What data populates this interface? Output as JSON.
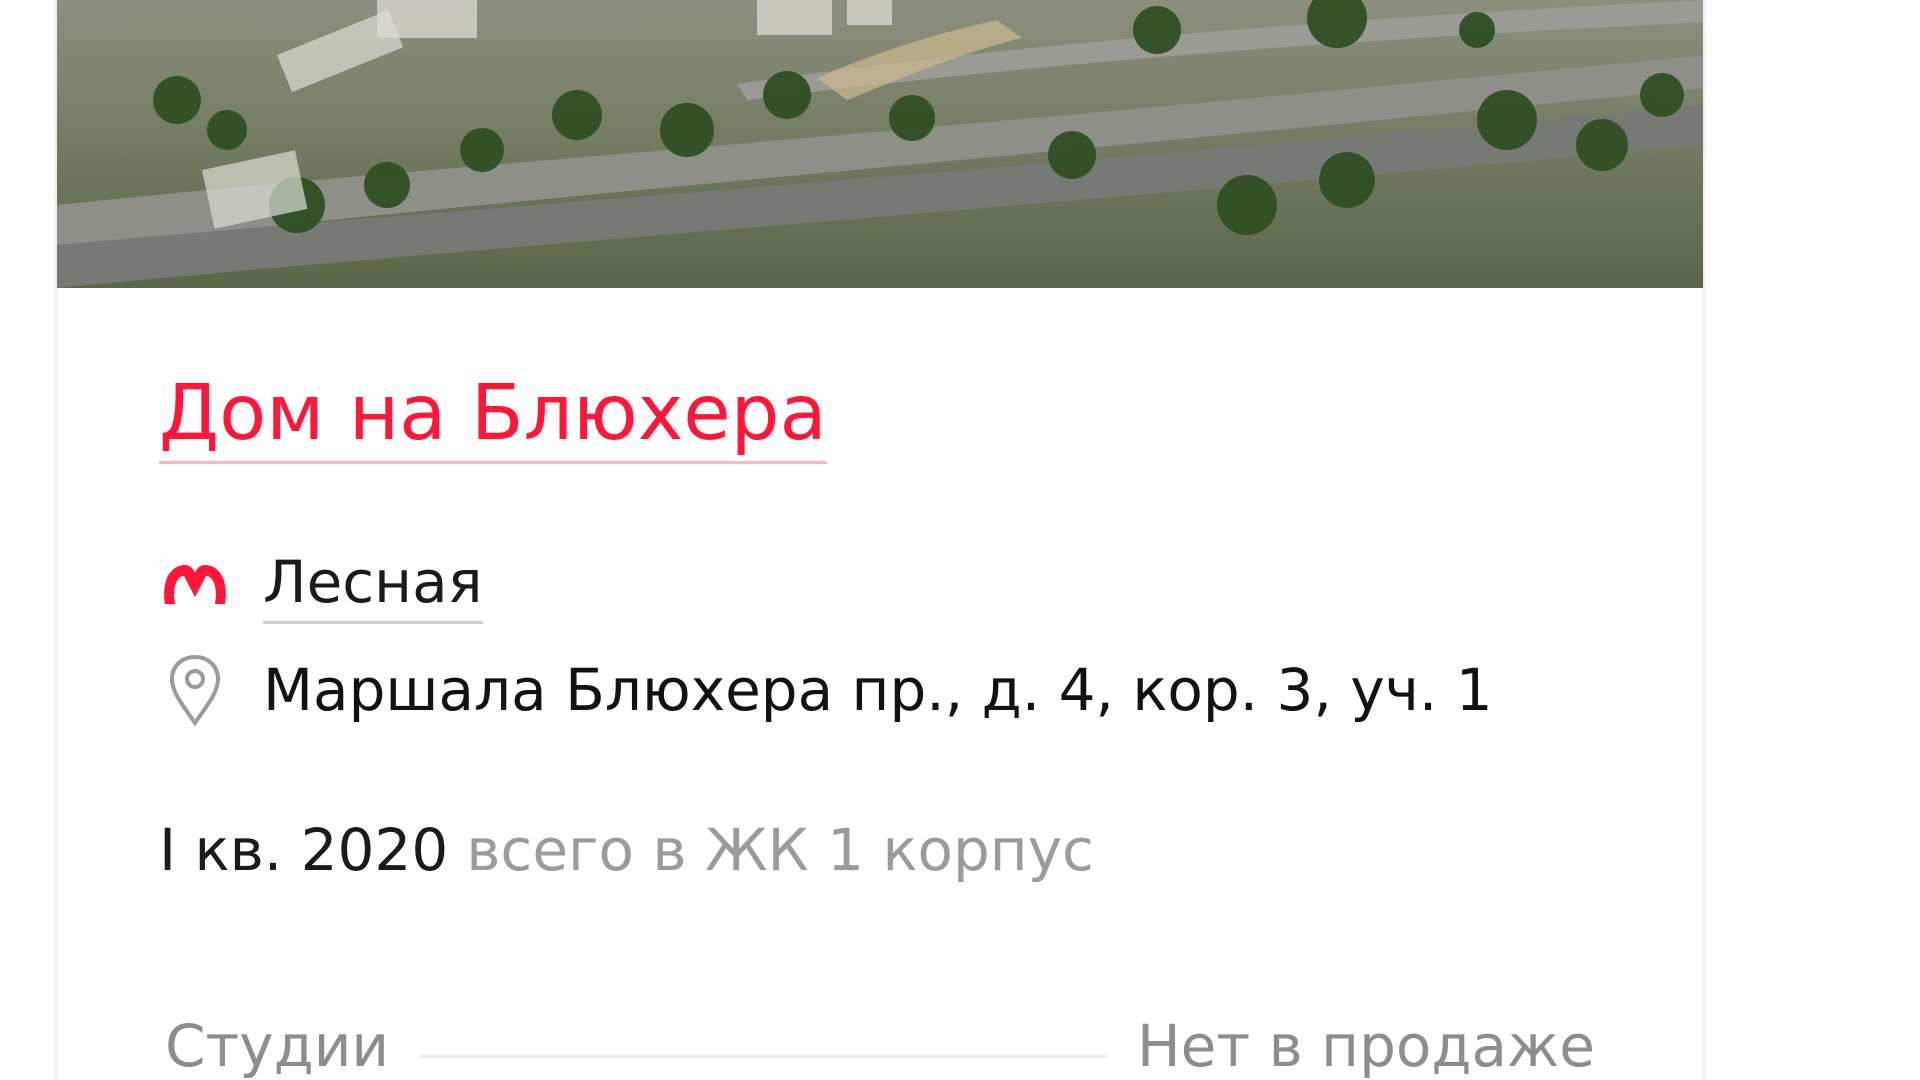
{
  "card": {
    "hero_alt": "",
    "title": "Дом на Блюхера",
    "metro": {
      "name": "Лесная",
      "icon": "metro-icon",
      "color": "#ff1639"
    },
    "address": {
      "text": "Маршала Блюхера пр., д. 4, кор. 3, уч. 1",
      "icon": "pin-icon"
    },
    "deadline": {
      "main": "I кв. 2020",
      "sub": "всего в ЖК 1 корпус"
    },
    "unit_type": {
      "label": "Студии",
      "value": "Нет в продаже"
    }
  }
}
